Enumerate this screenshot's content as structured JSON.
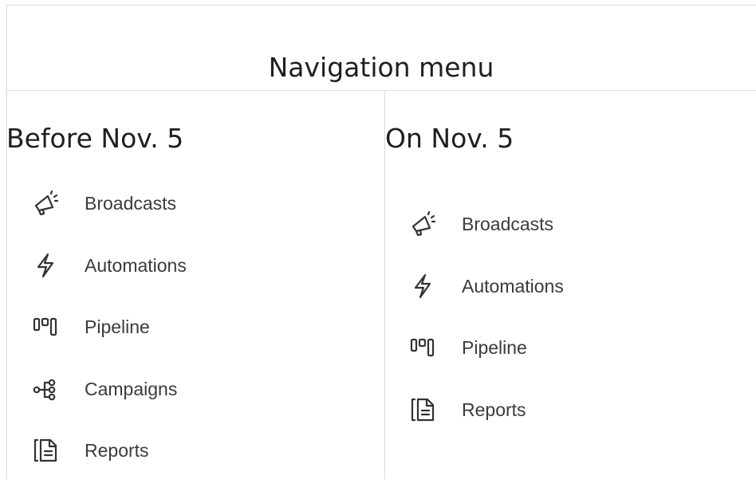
{
  "header": {
    "title": "Navigation menu"
  },
  "before": {
    "title": "Before Nov. 5",
    "items": [
      {
        "label": "Broadcasts",
        "icon": "megaphone-icon"
      },
      {
        "label": "Automations",
        "icon": "lightning-icon"
      },
      {
        "label": "Pipeline",
        "icon": "pipeline-icon"
      },
      {
        "label": "Campaigns",
        "icon": "flow-icon"
      },
      {
        "label": "Reports",
        "icon": "report-icon"
      }
    ]
  },
  "after": {
    "title": "On Nov. 5",
    "items": [
      {
        "label": "Broadcasts",
        "icon": "megaphone-icon"
      },
      {
        "label": "Automations",
        "icon": "lightning-icon"
      },
      {
        "label": "Pipeline",
        "icon": "pipeline-icon"
      },
      {
        "label": "Reports",
        "icon": "report-icon"
      }
    ]
  },
  "colors": {
    "text": "#3b3b3b",
    "border": "#d9d9d9",
    "icon": "#333333"
  }
}
